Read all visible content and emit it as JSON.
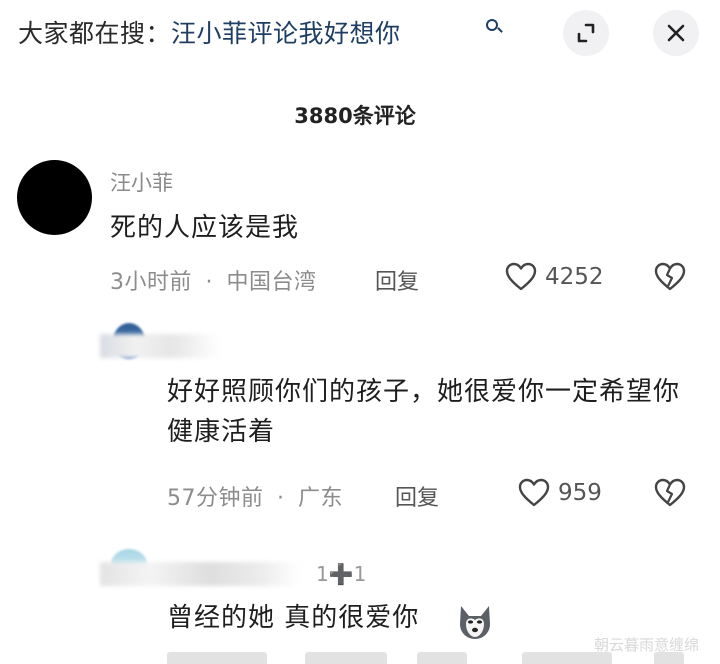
{
  "search": {
    "label": "大家都在搜：",
    "term": "汪小菲评论我好想你"
  },
  "comment_count": "3880条评论",
  "comments": [
    {
      "username": "汪小菲",
      "text": "死的人应该是我",
      "time": "3小时前",
      "location": "中国台湾",
      "reply_label": "回复",
      "likes": "4252"
    },
    {
      "username": "",
      "text": "好好照顾你们的孩子，她很爱你一定希望你健康活着",
      "time": "57分钟前",
      "location": "广东",
      "reply_label": "回复",
      "likes": "959"
    },
    {
      "username": "",
      "tag": "1➕1",
      "text": "曾经的她 真的很爱你",
      "emoji": "husky-emoji"
    }
  ],
  "separator": "·",
  "watermark": "朝云暮雨意缠绵",
  "icons": {
    "search": "search-icon",
    "expand": "expand-icon",
    "close": "close-icon",
    "like": "heart-icon",
    "dislike": "broken-heart-icon"
  }
}
